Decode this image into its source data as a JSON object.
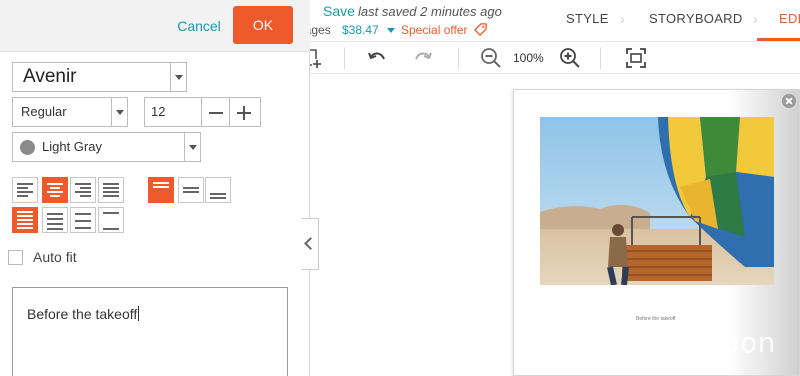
{
  "panel": {
    "cancel_label": "Cancel",
    "ok_label": "OK",
    "font_family": "Avenir",
    "font_style": "Regular",
    "font_size": "12",
    "text_color_name": "Light Gray",
    "text_color_hex": "#8a8a8a",
    "autofit_label": "Auto fit",
    "autofit_checked": false,
    "text_value": "Before the takeoff"
  },
  "topbar": {
    "save_label": "Save",
    "last_saved": "last saved 2 minutes ago",
    "pages_label": "pages",
    "price": "$38.47",
    "special_offer": "Special offer",
    "steps": [
      "STYLE",
      "STORYBOARD",
      "EDIT"
    ],
    "active_step": "EDIT"
  },
  "toolbar": {
    "zoom_level": "100%"
  },
  "canvas": {
    "caption": "Before the takeoff"
  },
  "watermark": {
    "text": "DealMoon"
  },
  "colors": {
    "accent": "#ee5a2b",
    "link": "#1a9aa8"
  }
}
